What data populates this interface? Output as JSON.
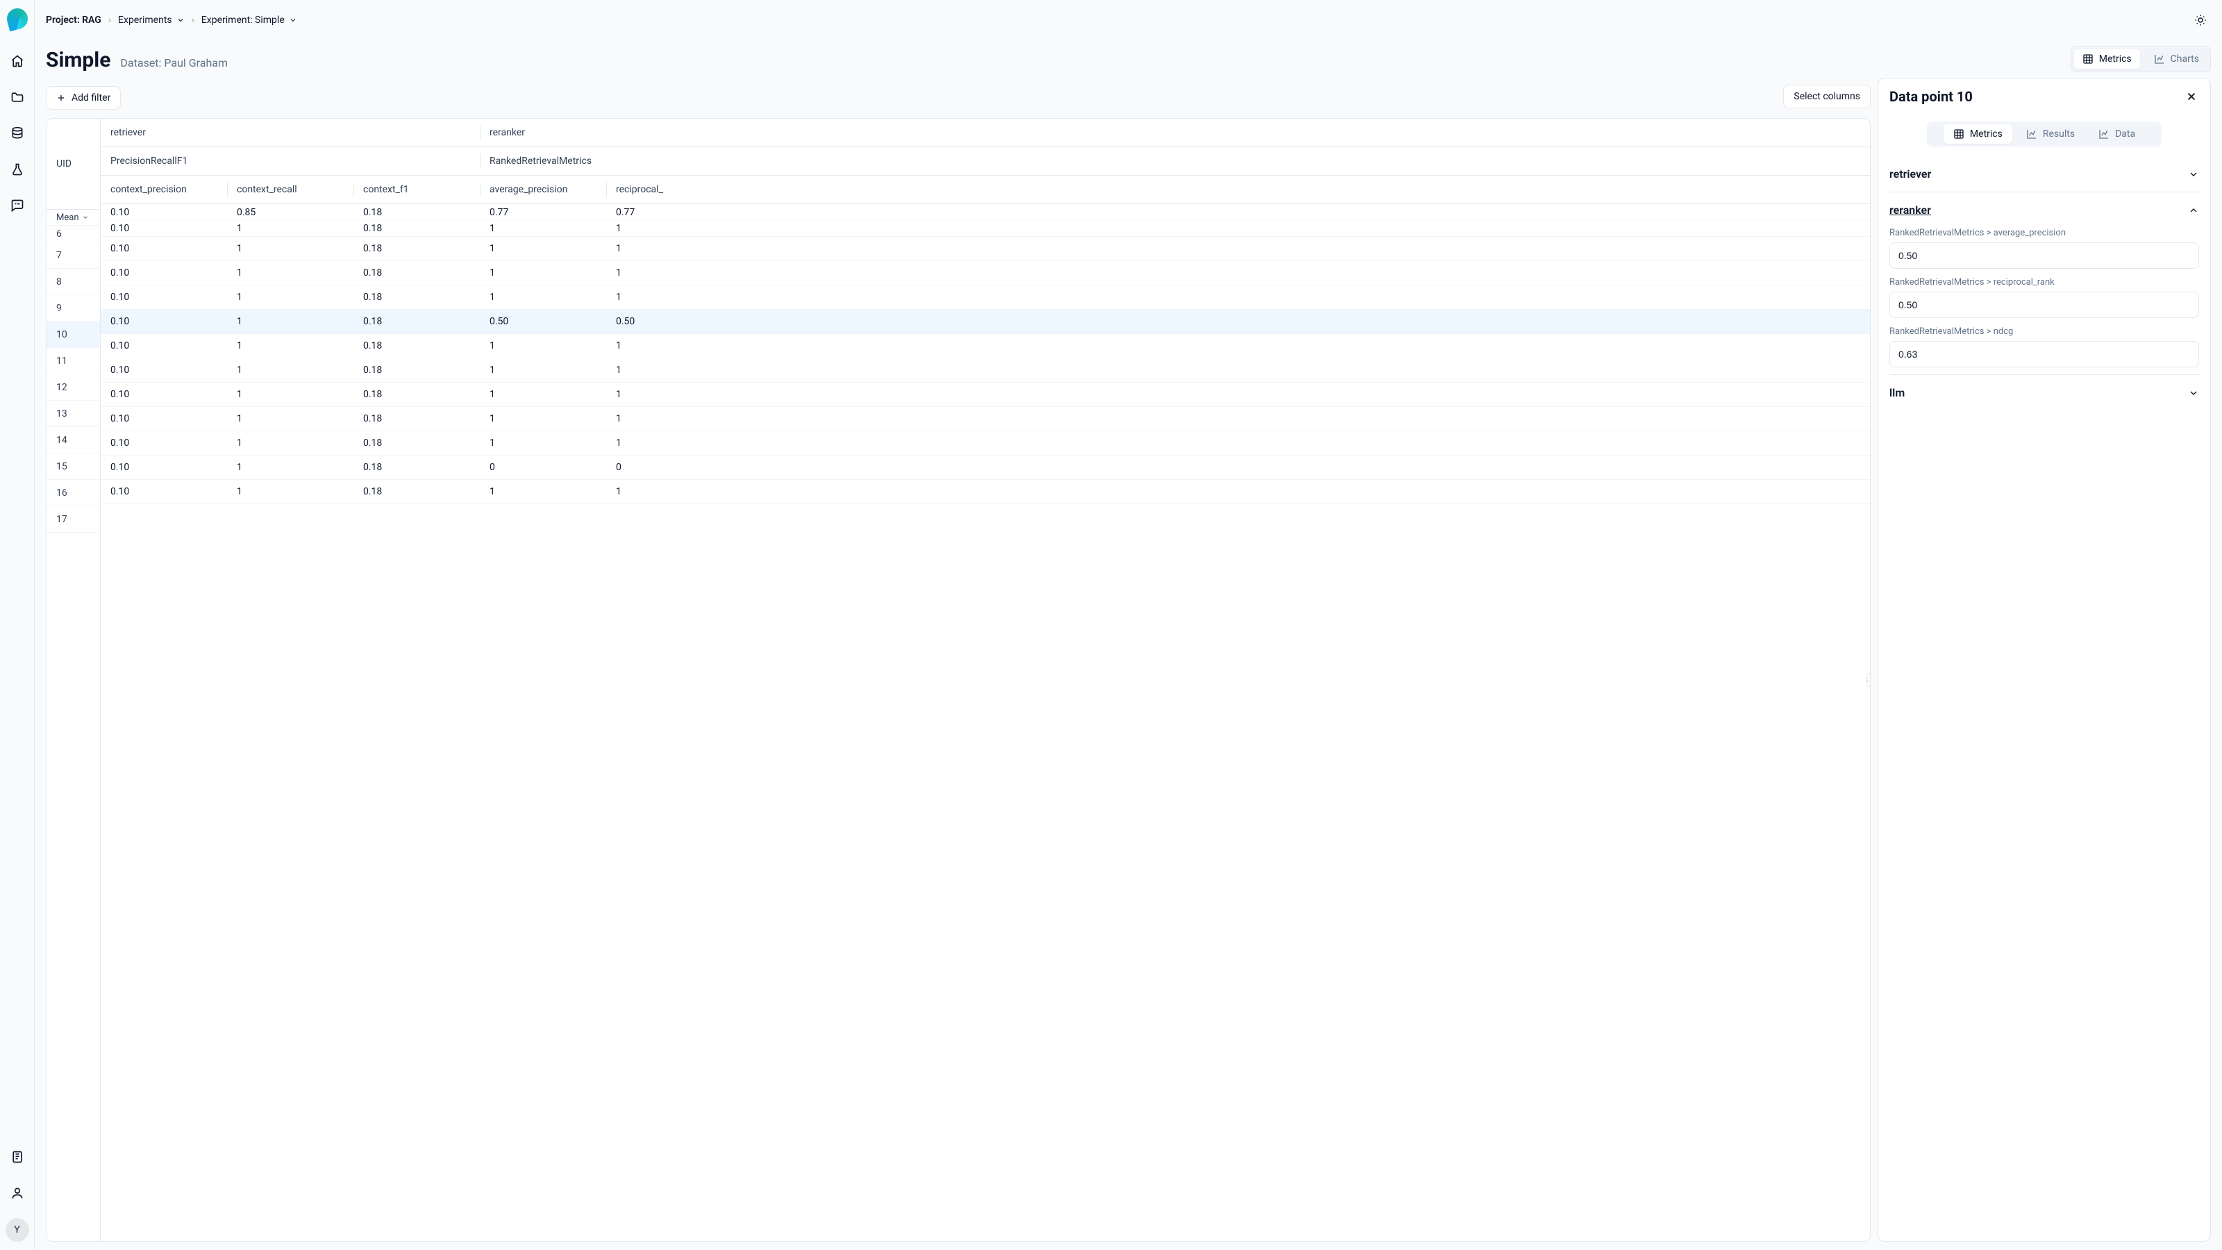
{
  "sidebar": {
    "avatar_initial": "Y"
  },
  "breadcrumb": {
    "project": "Project: RAG",
    "experiments": "Experiments",
    "experiment": "Experiment: Simple"
  },
  "page": {
    "title": "Simple",
    "dataset": "Dataset: Paul Graham"
  },
  "view_toggle": {
    "metrics": "Metrics",
    "charts": "Charts"
  },
  "toolbar": {
    "add_filter": "Add filter",
    "select_columns": "Select columns"
  },
  "table": {
    "uid_label": "UID",
    "agg_label": "Mean",
    "groups": [
      "retriever",
      "reranker"
    ],
    "metric_groups": [
      "PrecisionRecallF1",
      "RankedRetrievalMetrics"
    ],
    "columns": [
      "context_precision",
      "context_recall",
      "context_f1",
      "average_precision",
      "reciprocal_"
    ],
    "mean_row": [
      "0.10",
      "0.85",
      "0.18",
      "0.77",
      "0.77"
    ],
    "rows": [
      {
        "uid": "6",
        "vals": [
          "0.10",
          "1",
          "0.18",
          "1",
          "1"
        ]
      },
      {
        "uid": "7",
        "vals": [
          "0.10",
          "1",
          "0.18",
          "1",
          "1"
        ]
      },
      {
        "uid": "8",
        "vals": [
          "0.10",
          "1",
          "0.18",
          "1",
          "1"
        ]
      },
      {
        "uid": "9",
        "vals": [
          "0.10",
          "1",
          "0.18",
          "1",
          "1"
        ]
      },
      {
        "uid": "10",
        "vals": [
          "0.10",
          "1",
          "0.18",
          "0.50",
          "0.50"
        ],
        "active": true
      },
      {
        "uid": "11",
        "vals": [
          "0.10",
          "1",
          "0.18",
          "1",
          "1"
        ]
      },
      {
        "uid": "12",
        "vals": [
          "0.10",
          "1",
          "0.18",
          "1",
          "1"
        ]
      },
      {
        "uid": "13",
        "vals": [
          "0.10",
          "1",
          "0.18",
          "1",
          "1"
        ]
      },
      {
        "uid": "14",
        "vals": [
          "0.10",
          "1",
          "0.18",
          "1",
          "1"
        ]
      },
      {
        "uid": "15",
        "vals": [
          "0.10",
          "1",
          "0.18",
          "1",
          "1"
        ]
      },
      {
        "uid": "16",
        "vals": [
          "0.10",
          "1",
          "0.18",
          "0",
          "0"
        ]
      },
      {
        "uid": "17",
        "vals": [
          "0.10",
          "1",
          "0.18",
          "1",
          "1"
        ]
      }
    ]
  },
  "detail": {
    "title": "Data point 10",
    "tabs": {
      "metrics": "Metrics",
      "results": "Results",
      "data": "Data"
    },
    "sections": {
      "retriever": "retriever",
      "reranker": "reranker",
      "llm": "llm"
    },
    "fields": [
      {
        "label": "RankedRetrievalMetrics > average_precision",
        "value": "0.50"
      },
      {
        "label": "RankedRetrievalMetrics > reciprocal_rank",
        "value": "0.50"
      },
      {
        "label": "RankedRetrievalMetrics > ndcg",
        "value": "0.63"
      }
    ]
  }
}
